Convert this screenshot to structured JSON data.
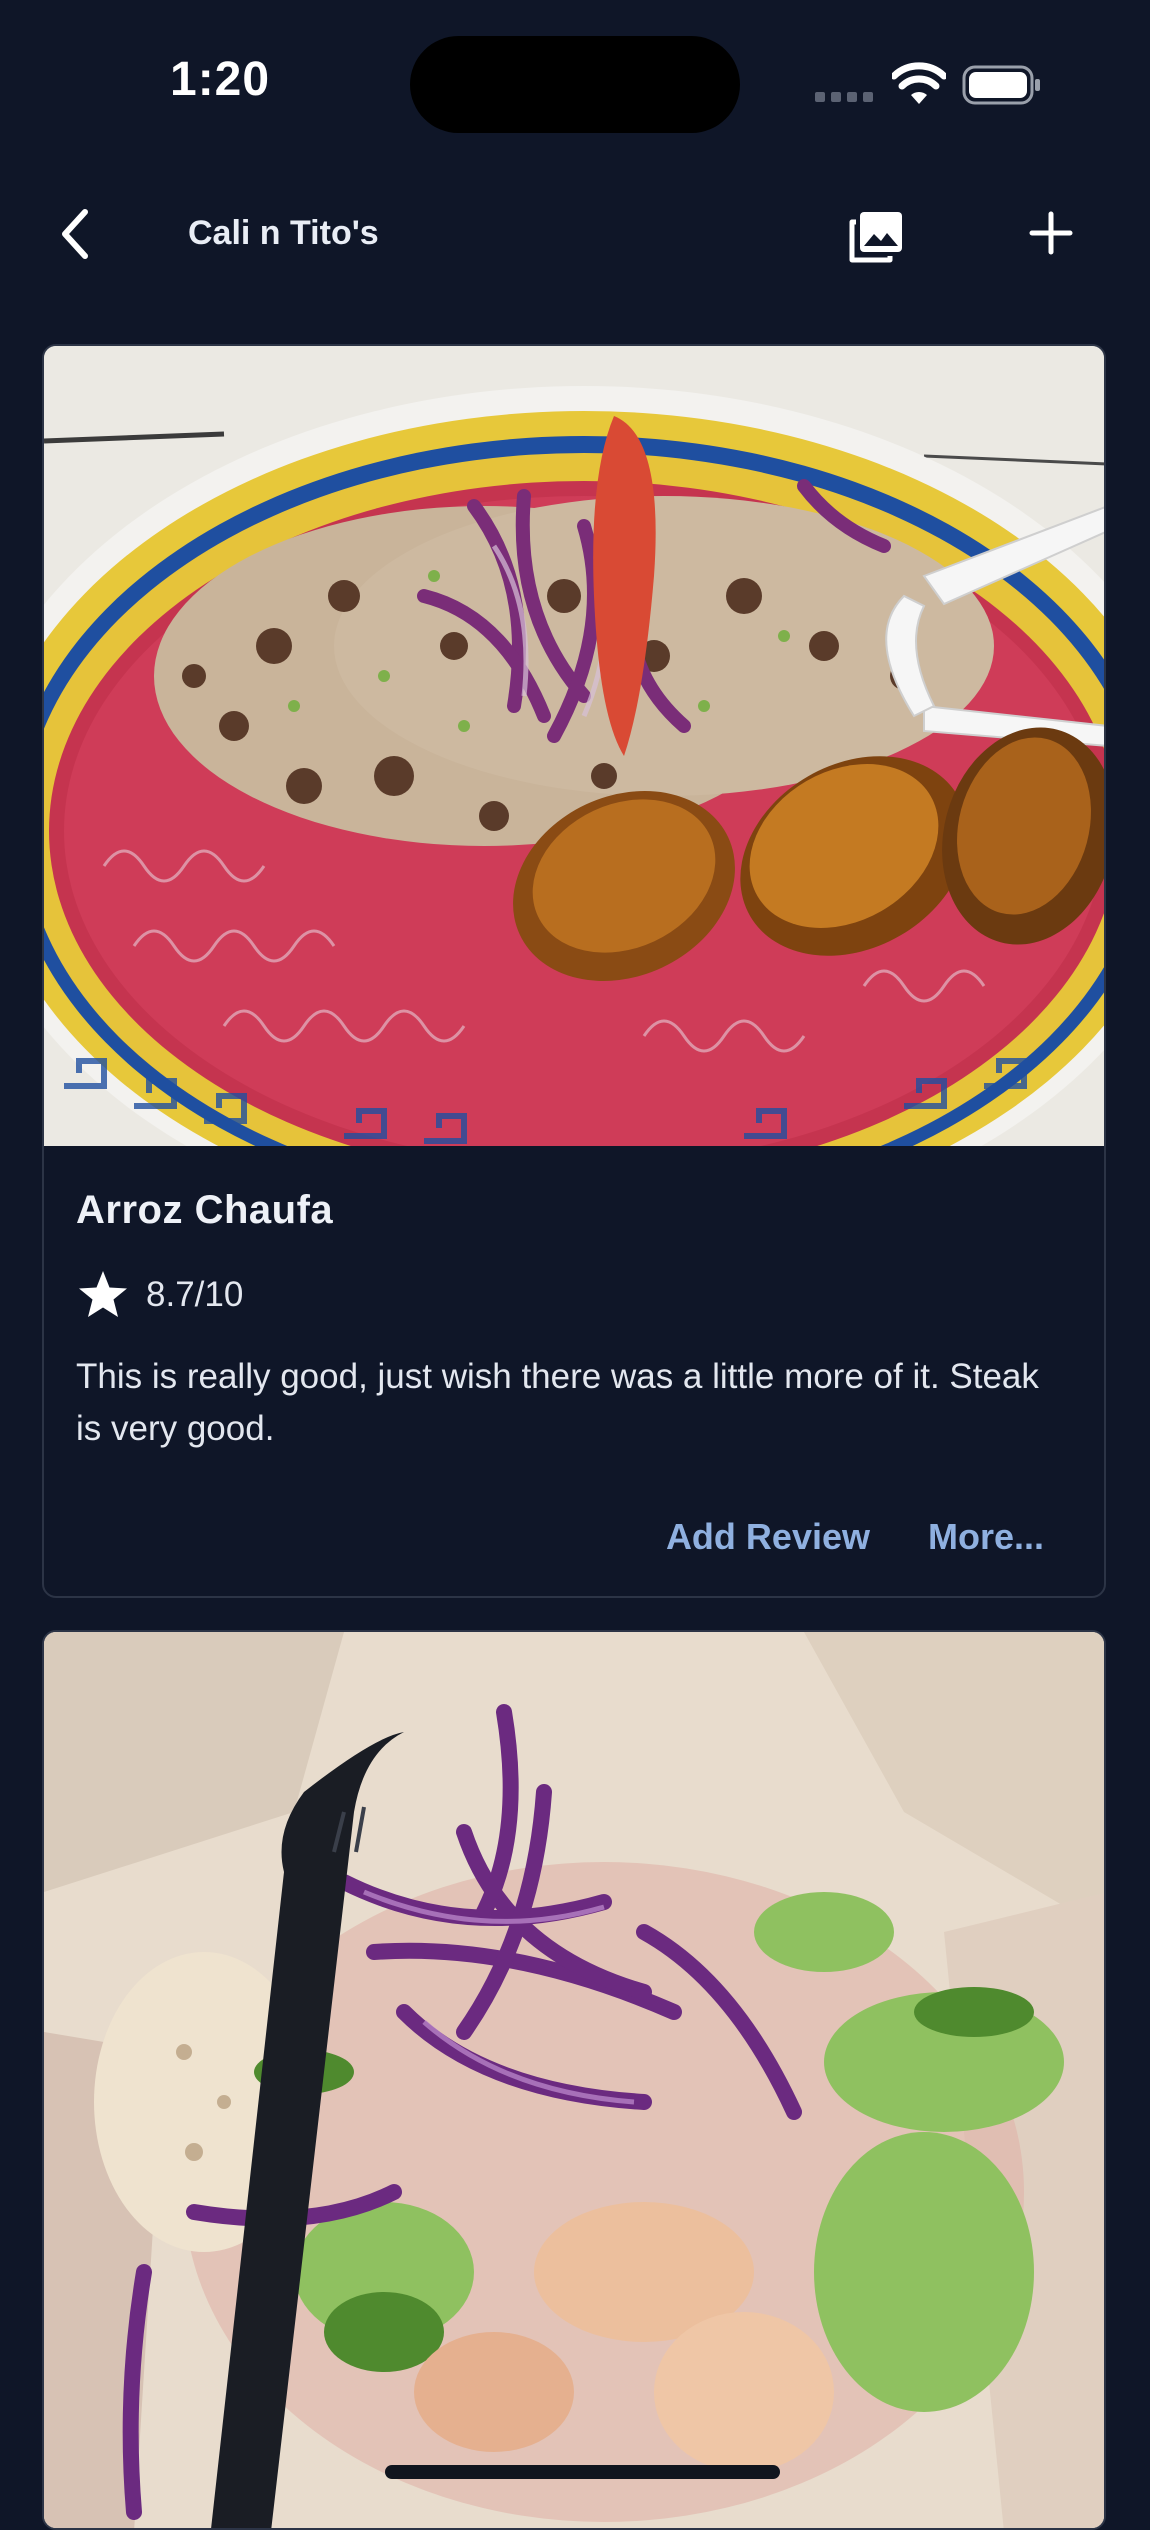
{
  "status_bar": {
    "time": "1:20"
  },
  "nav": {
    "title": "Cali n Tito's",
    "back_icon": "chevron-left-icon",
    "gallery_icon": "photo-library-icon",
    "add_icon": "plus-icon"
  },
  "cards": [
    {
      "name": "Arroz Chaufa",
      "rating": "8.7/10",
      "review": "This is really good, just wish there was a little more of it. Steak is very good.",
      "add_review_label": "Add Review",
      "more_label": "More..."
    }
  ],
  "colors": {
    "background": "#0f1628",
    "accent_link": "#8fb0e0",
    "card_border": "#2c3446",
    "text": "#e3e7ef"
  }
}
